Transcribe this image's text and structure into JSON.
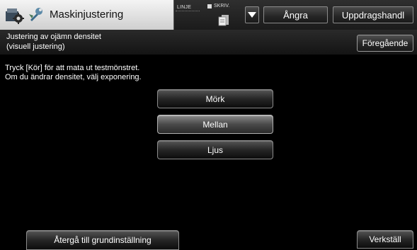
{
  "header": {
    "title": "Maskinjustering",
    "line_label": "LINJE",
    "print_label": "SKRIV.",
    "undo_label": "Ångra",
    "job_status_label": "Uppdragshandl"
  },
  "subheader": {
    "title_line_1": "Justering av ojämn densitet",
    "title_line_2": "(visuell justering)",
    "previous_label": "Föregående"
  },
  "main": {
    "instruction_line_1": "Tryck [Kör] för att mata ut testmönstret.",
    "instruction_line_2": "Om du ändrar densitet, välj exponering.",
    "options": [
      {
        "label": "Mörk",
        "selected": false
      },
      {
        "label": "Mellan",
        "selected": true
      },
      {
        "label": "Ljus",
        "selected": false
      }
    ]
  },
  "footer": {
    "reset_label": "Återgå till grundinställning",
    "apply_label": "Verkställ"
  },
  "icons": {
    "machine": "machine-settings-icon",
    "wrench": "wrench-icon",
    "job": "job-icon",
    "dropdown": "chevron-down-icon"
  }
}
